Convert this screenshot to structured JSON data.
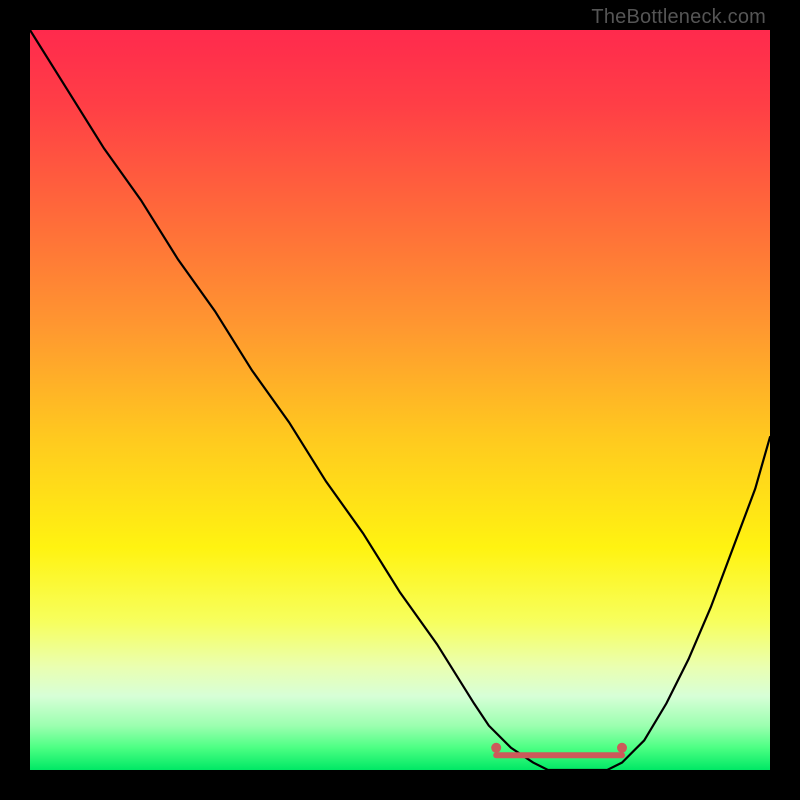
{
  "watermark": "TheBottleneck.com",
  "gradient": {
    "stops": [
      {
        "offset": 0.0,
        "color": "#ff2a4d"
      },
      {
        "offset": 0.1,
        "color": "#ff3e46"
      },
      {
        "offset": 0.25,
        "color": "#ff6a3a"
      },
      {
        "offset": 0.4,
        "color": "#ff9730"
      },
      {
        "offset": 0.55,
        "color": "#ffc91f"
      },
      {
        "offset": 0.7,
        "color": "#fff311"
      },
      {
        "offset": 0.8,
        "color": "#f7ff5e"
      },
      {
        "offset": 0.86,
        "color": "#eaffb0"
      },
      {
        "offset": 0.9,
        "color": "#d7ffd7"
      },
      {
        "offset": 0.94,
        "color": "#9cffb0"
      },
      {
        "offset": 0.97,
        "color": "#4cff83"
      },
      {
        "offset": 1.0,
        "color": "#00e865"
      }
    ]
  },
  "chart_data": {
    "type": "line",
    "title": "",
    "xlabel": "",
    "ylabel": "",
    "xlim": [
      0,
      100
    ],
    "ylim": [
      0,
      100
    ],
    "series": [
      {
        "name": "bottleneck-curve",
        "x": [
          0,
          5,
          10,
          15,
          20,
          25,
          30,
          35,
          40,
          45,
          50,
          55,
          60,
          62,
          65,
          68,
          70,
          72,
          75,
          78,
          80,
          83,
          86,
          89,
          92,
          95,
          98,
          100
        ],
        "values": [
          100,
          92,
          84,
          77,
          69,
          62,
          54,
          47,
          39,
          32,
          24,
          17,
          9,
          6,
          3,
          1,
          0,
          0,
          0,
          0,
          1,
          4,
          9,
          15,
          22,
          30,
          38,
          45
        ]
      }
    ],
    "markers": [
      {
        "name": "optimum-left",
        "x": 63,
        "y": 3,
        "color": "#cc5a5a",
        "r": 5
      },
      {
        "name": "optimum-right",
        "x": 80,
        "y": 3,
        "color": "#cc5a5a",
        "r": 5
      }
    ],
    "optimum_band": {
      "x0": 63,
      "x1": 80,
      "y": 2,
      "color": "#cc5a5a",
      "thickness": 6
    }
  }
}
